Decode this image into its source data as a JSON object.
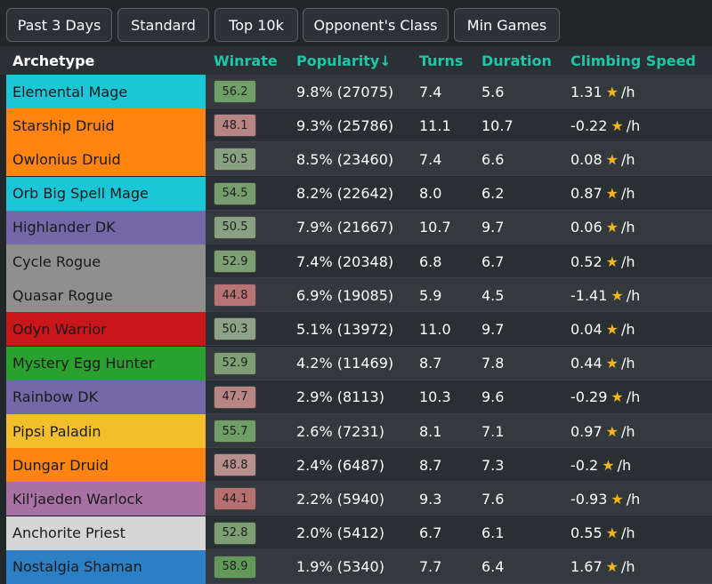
{
  "filters": [
    {
      "label": "Past 3 Days"
    },
    {
      "label": "Standard"
    },
    {
      "label": "Top 10k"
    },
    {
      "label": "Opponent's Class"
    },
    {
      "label": "Min Games"
    }
  ],
  "columns": {
    "archetype": "Archetype",
    "winrate": "Winrate",
    "popularity": "Popularity↓",
    "turns": "Turns",
    "duration": "Duration",
    "climbing": "Climbing Speed"
  },
  "star_unit": "/h",
  "rows": [
    {
      "name": "Elemental Mage",
      "class_color": "#1bc6d6",
      "winrate": "56.2",
      "winrate_color": "#6f9f66",
      "popularity": "9.8% (27075)",
      "turns": "7.4",
      "duration": "5.6",
      "climbing": "1.31"
    },
    {
      "name": "Starship Druid",
      "class_color": "#ff8411",
      "winrate": "48.1",
      "winrate_color": "#b88585",
      "popularity": "9.3% (25786)",
      "turns": "11.1",
      "duration": "10.7",
      "climbing": "-0.22"
    },
    {
      "name": "Owlonius Druid",
      "class_color": "#ff8411",
      "winrate": "50.5",
      "winrate_color": "#8aa082",
      "popularity": "8.5% (23460)",
      "turns": "7.4",
      "duration": "6.6",
      "climbing": "0.08"
    },
    {
      "name": "Orb Big Spell Mage",
      "class_color": "#1bc6d6",
      "winrate": "54.5",
      "winrate_color": "#759d6e",
      "popularity": "8.2% (22642)",
      "turns": "8.0",
      "duration": "6.2",
      "climbing": "0.87"
    },
    {
      "name": "Highlander DK",
      "class_color": "#7468a8",
      "winrate": "50.5",
      "winrate_color": "#8aa082",
      "popularity": "7.9% (21667)",
      "turns": "10.7",
      "duration": "9.7",
      "climbing": "0.06"
    },
    {
      "name": "Cycle Rogue",
      "class_color": "#8f8f8f",
      "winrate": "52.9",
      "winrate_color": "#7e9e74",
      "popularity": "7.4% (20348)",
      "turns": "6.8",
      "duration": "6.7",
      "climbing": "0.52"
    },
    {
      "name": "Quasar Rogue",
      "class_color": "#8f8f8f",
      "winrate": "44.8",
      "winrate_color": "#b77474",
      "popularity": "6.9% (19085)",
      "turns": "5.9",
      "duration": "4.5",
      "climbing": "-1.41"
    },
    {
      "name": "Odyn Warrior",
      "class_color": "#c8161b",
      "winrate": "50.3",
      "winrate_color": "#8da286",
      "popularity": "5.1% (13972)",
      "turns": "11.0",
      "duration": "9.7",
      "climbing": "0.04"
    },
    {
      "name": "Mystery Egg Hunter",
      "class_color": "#2aa12e",
      "winrate": "52.9",
      "winrate_color": "#7e9e74",
      "popularity": "4.2% (11469)",
      "turns": "8.7",
      "duration": "7.8",
      "climbing": "0.44"
    },
    {
      "name": "Rainbow DK",
      "class_color": "#7468a8",
      "winrate": "47.7",
      "winrate_color": "#b88585",
      "popularity": "2.9% (8113)",
      "turns": "10.3",
      "duration": "9.6",
      "climbing": "-0.29"
    },
    {
      "name": "Pipsi Paladin",
      "class_color": "#f2bf2a",
      "winrate": "55.7",
      "winrate_color": "#6f9f66",
      "popularity": "2.6% (7231)",
      "turns": "8.1",
      "duration": "7.1",
      "climbing": "0.97"
    },
    {
      "name": "Dungar Druid",
      "class_color": "#ff8411",
      "winrate": "48.8",
      "winrate_color": "#b88f8f",
      "popularity": "2.4% (6487)",
      "turns": "8.7",
      "duration": "7.3",
      "climbing": "-0.2"
    },
    {
      "name": "Kil'jaeden Warlock",
      "class_color": "#a771a3",
      "winrate": "44.1",
      "winrate_color": "#b77070",
      "popularity": "2.2% (5940)",
      "turns": "9.3",
      "duration": "7.6",
      "climbing": "-0.93"
    },
    {
      "name": "Anchorite Priest",
      "class_color": "#d6d6d6",
      "winrate": "52.8",
      "winrate_color": "#7e9e74",
      "popularity": "2.0% (5412)",
      "turns": "6.7",
      "duration": "6.1",
      "climbing": "0.55"
    },
    {
      "name": "Nostalgia Shaman",
      "class_color": "#2b7fc4",
      "winrate": "58.9",
      "winrate_color": "#63985b",
      "popularity": "1.9% (5340)",
      "turns": "7.7",
      "duration": "6.4",
      "climbing": "1.67"
    }
  ]
}
